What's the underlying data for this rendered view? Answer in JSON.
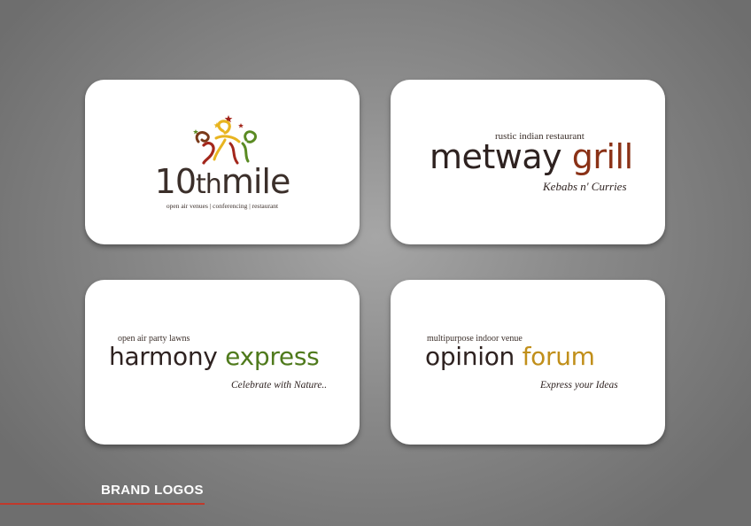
{
  "logos": [
    {
      "id": "10thmile",
      "name_part1": "10",
      "name_part2": "th",
      "name_part3": "mile",
      "tagline": "open air venues | conferencing | restaurant",
      "colors": {
        "text": "#3b2f2a",
        "red": "#a3261b",
        "yellow": "#e8b420",
        "brown": "#7a3a1a",
        "green": "#5a8a22"
      }
    },
    {
      "id": "metway-grill",
      "tagline": "rustic indian restaurant",
      "name_part1": "metway",
      "name_part2": "grill",
      "subtitle": "Kebabs n' Curries",
      "colors": {
        "text": "#2e2220",
        "accent": "#8a3116"
      }
    },
    {
      "id": "harmony-express",
      "tagline": "open air party lawns",
      "name_part1": "harmony",
      "name_part2": "express",
      "subtitle": "Celebrate with Nature..",
      "colors": {
        "text": "#2e2220",
        "accent": "#4f7a1c"
      }
    },
    {
      "id": "opinion-forum",
      "tagline": "multipurpose indoor venue",
      "name_part1": "opinion",
      "name_part2": "forum",
      "subtitle": "Express your Ideas",
      "colors": {
        "text": "#2e2220",
        "accent": "#c18f1a"
      }
    }
  ],
  "section": {
    "label": "BRAND LOGOS",
    "accent": "#c0392b"
  }
}
